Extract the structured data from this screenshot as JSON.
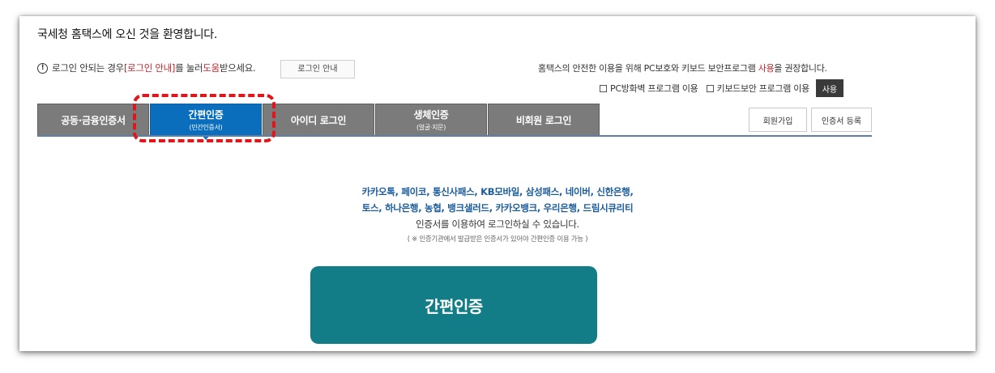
{
  "header": {
    "welcome": "국세청 홈택스에 오신 것을 환영합니다."
  },
  "notice": {
    "icon": "info-icon",
    "prefix": "로그인 안되는 경우 ",
    "link": "[로그인 안내]",
    "middle": "를 눌러 ",
    "help": "도움",
    "suffix": "받으세요.",
    "guide_button": "로그인 안내"
  },
  "recommend": {
    "prefix": "홈택스의 안전한 이용을 위해 PC보호와 키보드 보안프로그램 ",
    "highlight": "사용",
    "suffix": "을 권장합니다.",
    "checks": [
      "PC방화벽 프로그램 이용",
      "키보드보안 프로그램 이용"
    ],
    "use_button": "사용"
  },
  "tabs": [
    {
      "label": "공동·금융인증서",
      "sub": ""
    },
    {
      "label": "간편인증",
      "sub": "(민간인증서)"
    },
    {
      "label": "아이디 로그인",
      "sub": ""
    },
    {
      "label": "생체인증",
      "sub": "(얼굴·지문)"
    },
    {
      "label": "비회원 로그인",
      "sub": ""
    }
  ],
  "side_buttons": {
    "signup": "회원가입",
    "cert_register": "인증서 등록"
  },
  "content": {
    "providers_line1": "카카오톡, 페이코, 통신사패스, KB모바일, 삼성패스, 네이버, 신한은행,",
    "providers_line2": "토스, 하나은행, 농협, 뱅크샐러드, 카카오뱅크, 우리은행, 드림시큐리티",
    "description": "인증서를 이용하여 로그인하실 수 있습니다.",
    "note": "( ※ 인증기관에서 발급받은 인증서가 있어야 간편인증 이용 가능 )",
    "main_button": "간편인증"
  },
  "colors": {
    "active_tab": "#0a6ebd",
    "inactive_tab": "#7b7b7b",
    "main_button": "#127d86",
    "highlight": "#e0161b",
    "provider_text": "#1a5c9c"
  }
}
